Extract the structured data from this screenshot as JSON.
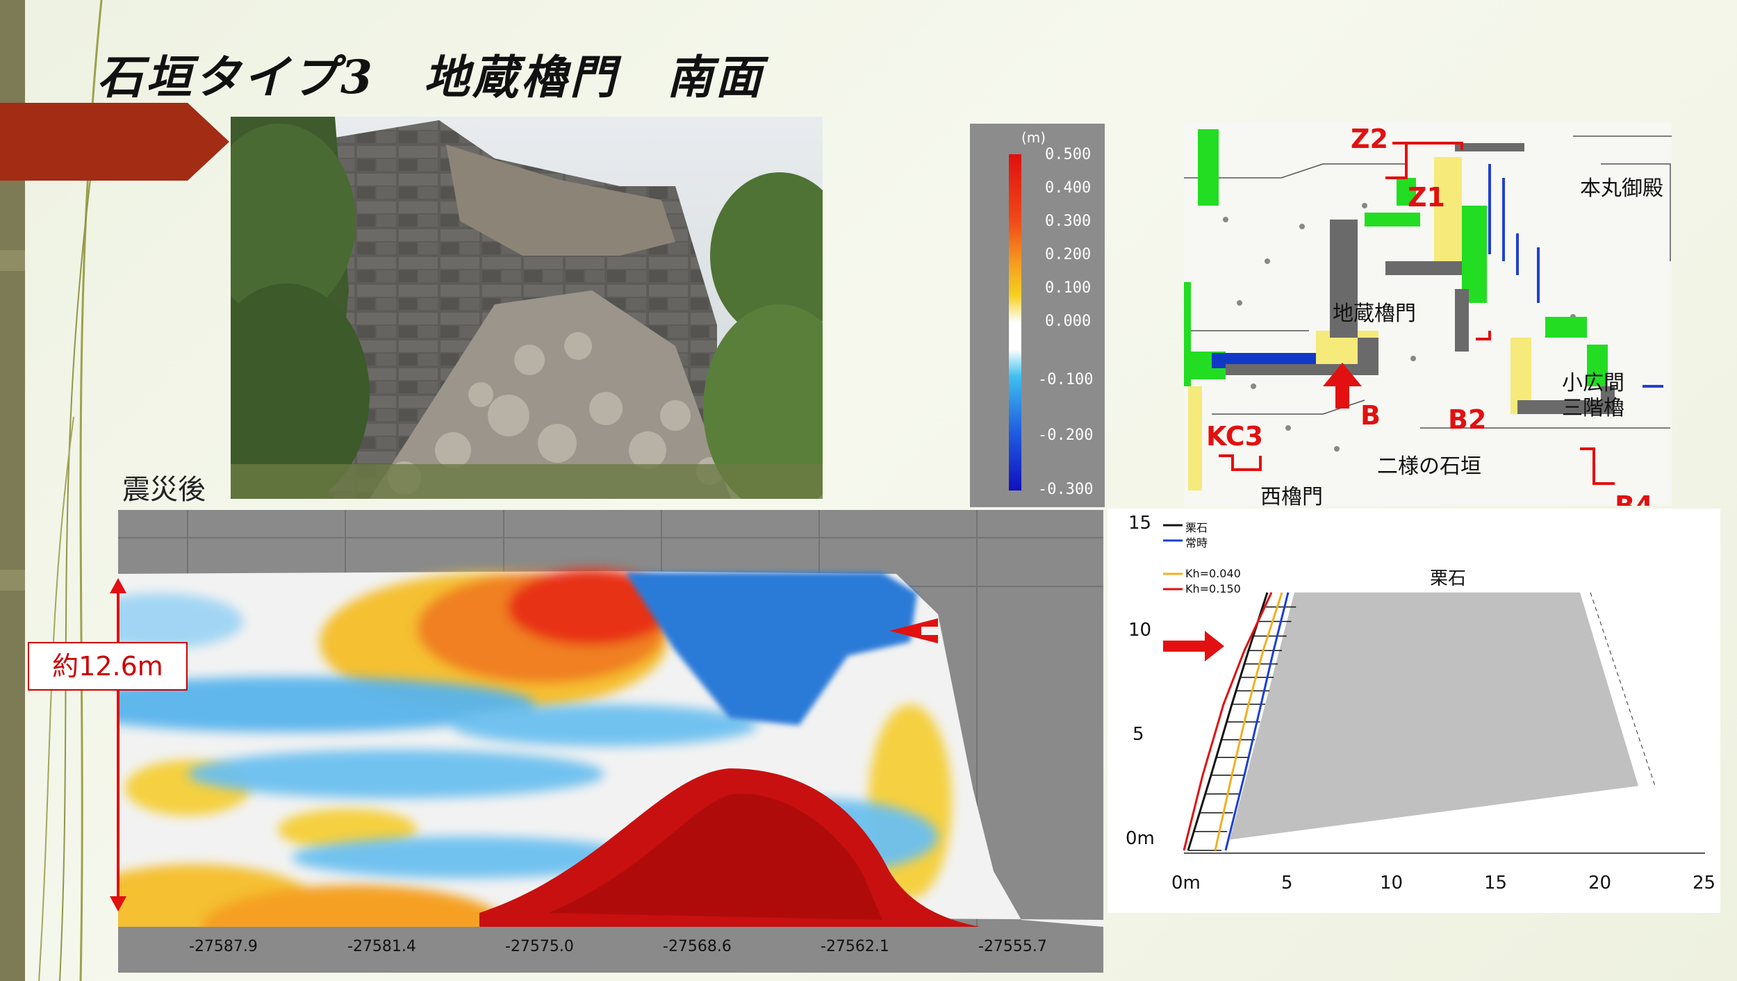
{
  "slide": {
    "title": "石垣タイプ3　地蔵櫓門　南面",
    "colors": {
      "accent_arrow": "#a32c14",
      "left_bar": "#7c7b55"
    }
  },
  "photo": {
    "caption": "震災後"
  },
  "color_legend": {
    "unit": "(m)",
    "labels": [
      "0.500",
      "0.400",
      "0.300",
      "0.200",
      "0.100",
      "0.000",
      "-0.100",
      "-0.200",
      "-0.300"
    ]
  },
  "map": {
    "labels": {
      "honmaru": "本丸御殿",
      "jizo": "地蔵櫓門",
      "kohiroma": "小広間",
      "sangai": "三階櫓",
      "nisama": "二様の石垣",
      "nishi": "西櫓門"
    },
    "codes": {
      "z2": "Z2",
      "z1": "Z1",
      "b": "B",
      "b2": "B2",
      "kc3": "KC3",
      "b4": "B4"
    }
  },
  "deformation": {
    "dimension": "約12.6m",
    "x_ticks": [
      "-27587.9",
      "-27581.4",
      "-27575.0",
      "-27568.6",
      "-27562.1",
      "-27555.7"
    ]
  },
  "chart_data": {
    "type": "line",
    "title": "",
    "annotation": "栗石",
    "xlabel": "",
    "ylabel": "",
    "xlim": [
      0,
      25
    ],
    "ylim": [
      0,
      15
    ],
    "x_ticks": [
      "0m",
      "5",
      "10",
      "15",
      "20",
      "25"
    ],
    "y_ticks": [
      "0m",
      "5",
      "10",
      "15"
    ],
    "legend_position": "top-left",
    "series": [
      {
        "name": "栗石",
        "color": "#111111",
        "points": [
          [
            0.2,
            0
          ],
          [
            1.3,
            3.5
          ],
          [
            2.3,
            6.8
          ],
          [
            3.1,
            9.3
          ],
          [
            4.0,
            12.0
          ]
        ]
      },
      {
        "name": "常時",
        "color": "#1a3fd6",
        "points": [
          [
            2.0,
            0
          ],
          [
            2.9,
            3.5
          ],
          [
            3.7,
            6.8
          ],
          [
            4.3,
            9.3
          ],
          [
            5.0,
            12.0
          ]
        ]
      },
      {
        "name": "Kh=0.040",
        "color": "#f0b020",
        "points": [
          [
            1.5,
            0
          ],
          [
            2.3,
            3.5
          ],
          [
            3.1,
            6.8
          ],
          [
            3.8,
            9.3
          ],
          [
            4.7,
            12.0
          ]
        ]
      },
      {
        "name": "Kh=0.150",
        "color": "#e01010",
        "points": [
          [
            0.0,
            0
          ],
          [
            0.9,
            3.5
          ],
          [
            1.9,
            6.8
          ],
          [
            2.9,
            9.3
          ],
          [
            4.2,
            12.0
          ]
        ]
      }
    ],
    "fill_region": {
      "name": "栗石",
      "color": "#c0c0c0",
      "points": [
        [
          2.2,
          0.5
        ],
        [
          5.3,
          12.0
        ],
        [
          19.0,
          12.0
        ],
        [
          21.8,
          3.0
        ]
      ]
    }
  }
}
